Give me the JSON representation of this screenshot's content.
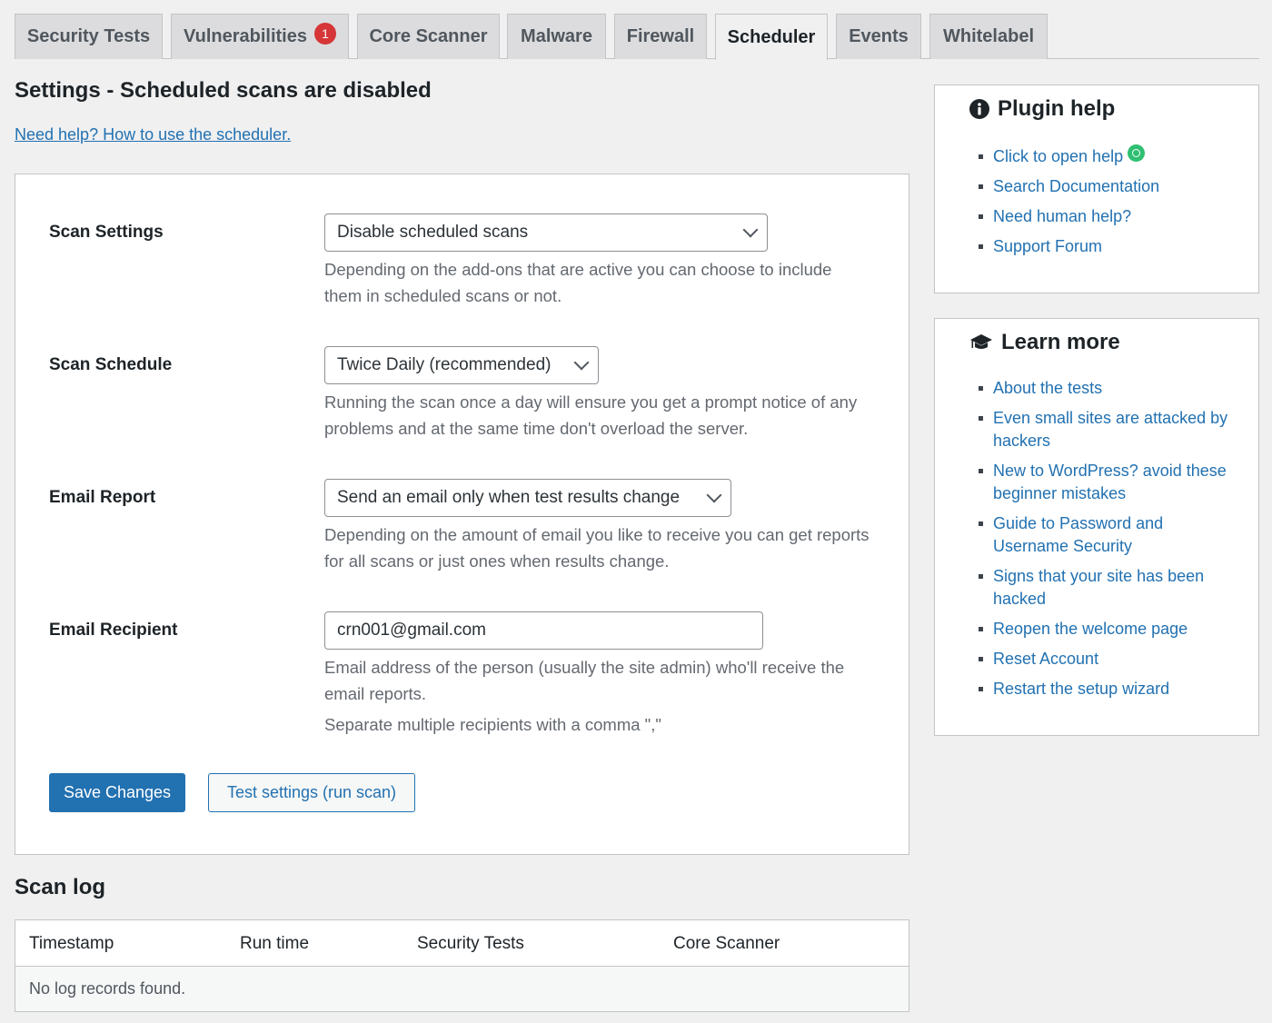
{
  "tabs": [
    {
      "label": "Security Tests"
    },
    {
      "label": "Vulnerabilities",
      "badge": "1"
    },
    {
      "label": "Core Scanner"
    },
    {
      "label": "Malware"
    },
    {
      "label": "Firewall"
    },
    {
      "label": "Scheduler",
      "active": true
    },
    {
      "label": "Events"
    },
    {
      "label": "Whitelabel"
    }
  ],
  "page_title": "Settings - Scheduled scans are disabled",
  "help_link": "Need help? How to use the scheduler.",
  "settings": {
    "scan_settings": {
      "label": "Scan Settings",
      "value": "Disable scheduled scans",
      "desc": "Depending on the add-ons that are active you can choose to include them in scheduled scans or not."
    },
    "scan_schedule": {
      "label": "Scan Schedule",
      "value": "Twice Daily (recommended)",
      "desc": "Running the scan once a day will ensure you get a prompt notice of any problems and at the same time don't overload the server."
    },
    "email_report": {
      "label": "Email Report",
      "value": "Send an email only when test results change",
      "desc": "Depending on the amount of email you like to receive you can get reports for all scans or just ones when results change."
    },
    "email_recipient": {
      "label": "Email Recipient",
      "value": "crn001@gmail.com",
      "desc": "Email address of the person (usually the site admin) who'll receive the email reports.",
      "desc2": "Separate multiple recipients with a comma \",\""
    },
    "save_label": "Save Changes",
    "test_label": "Test settings (run scan)"
  },
  "scan_log": {
    "title": "Scan log",
    "columns": [
      "Timestamp",
      "Run time",
      "Security Tests",
      "Core Scanner"
    ],
    "empty": "No log records found."
  },
  "plugin_help": {
    "title": "Plugin help",
    "icon": "info-icon",
    "items": [
      "Click to open help",
      "Search Documentation",
      "Need human help?",
      "Support Forum"
    ]
  },
  "learn_more": {
    "title": "Learn more",
    "icon": "graduation-cap-icon",
    "items": [
      "About the tests",
      "Even small sites are attacked by hackers",
      "New to WordPress? avoid these beginner mistakes",
      "Guide to Password and Username Security",
      "Signs that your site has been hacked",
      "Reopen the welcome page",
      "Reset Account",
      "Restart the setup wizard"
    ]
  },
  "colors": {
    "accent": "#2271b1",
    "badge": "#d63638",
    "status_dot": "#2fbf71"
  }
}
